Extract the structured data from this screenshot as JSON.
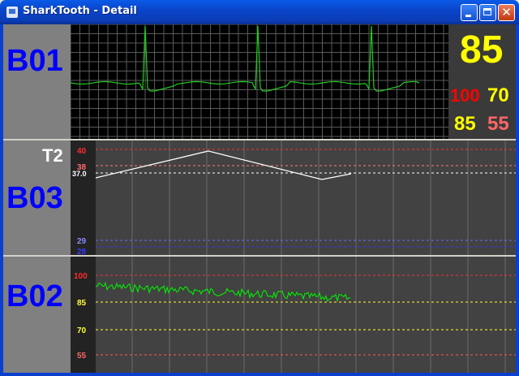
{
  "window": {
    "title": "SharkTooth - Detail",
    "close_glyph": "✕"
  },
  "panels": [
    {
      "bed": "B01",
      "main_value": "85",
      "values": [
        {
          "text": "100",
          "color": "#ff0000"
        },
        {
          "text": "70",
          "color": "#ffff00"
        },
        {
          "text": "85",
          "color": "#ffff00"
        },
        {
          "text": "55",
          "color": "#ff6666"
        }
      ]
    },
    {
      "bed": "B03",
      "param": "T2",
      "ticks": [
        {
          "text": "40",
          "color": "#ff2a2a"
        },
        {
          "text": "38",
          "color": "#ff6a6a"
        },
        {
          "text": "37.0",
          "color": "#ffffff"
        },
        {
          "text": "29",
          "color": "#8a8aff"
        },
        {
          "text": "28",
          "color": "#3a3aff"
        }
      ]
    },
    {
      "bed": "B02",
      "ticks": [
        {
          "text": "100",
          "color": "#ff2a2a"
        },
        {
          "text": "85",
          "color": "#ffff33"
        },
        {
          "text": "70",
          "color": "#ffff33"
        },
        {
          "text": "55",
          "color": "#ff6666"
        }
      ]
    }
  ],
  "colors": {
    "bed_label": "#0000ff",
    "ecg_trace": "#22cc22",
    "temp_trace": "#ffffff",
    "spo2_trace": "#00ee00",
    "grid": "#5a5a5a"
  }
}
